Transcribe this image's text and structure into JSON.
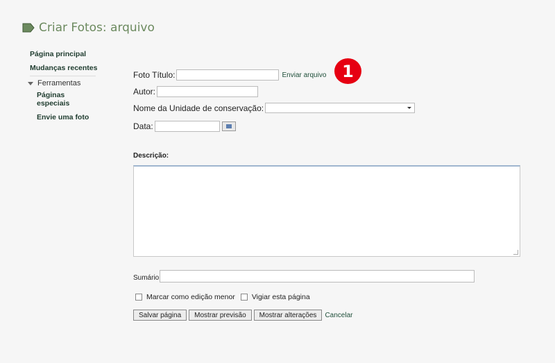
{
  "page": {
    "title": "Criar Fotos: arquivo"
  },
  "sidebar": {
    "links": [
      "Página principal",
      "Mudanças recentes"
    ],
    "section": "Ferramentas",
    "sublinks": [
      "Páginas especiais",
      "Envie uma foto"
    ]
  },
  "form": {
    "foto_titulo_label": "Foto Título:",
    "foto_titulo_value": "",
    "upload_link": "Enviar arquivo",
    "autor_label": "Autor:",
    "autor_value": "",
    "unidade_label": "Nome da Unidade de conservação:",
    "unidade_value": "",
    "data_label": "Data:",
    "data_value": "",
    "descricao_label": "Descrição:",
    "descricao_value": "",
    "sumario_label": "Sumário:",
    "sumario_value": "",
    "checkbox_minor": "Marcar como edição menor",
    "checkbox_watch": "Vigiar esta página",
    "btn_save": "Salvar página",
    "btn_preview": "Mostrar previsão",
    "btn_changes": "Mostrar alterações",
    "cancel": "Cancelar"
  },
  "annotation": {
    "badge_number": "1"
  },
  "colors": {
    "title": "#6c8a5f",
    "link": "#1f3c2f",
    "badge": "#e60012",
    "background": "#f6f6f6"
  }
}
